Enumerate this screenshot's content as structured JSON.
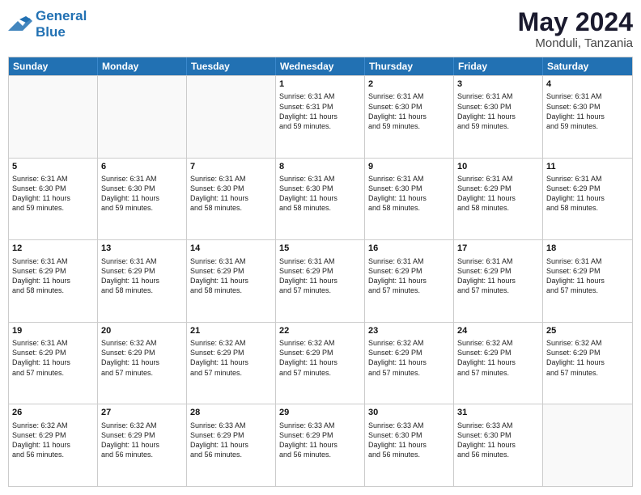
{
  "logo": {
    "line1": "General",
    "line2": "Blue"
  },
  "title": {
    "month_year": "May 2024",
    "location": "Monduli, Tanzania"
  },
  "header_days": [
    "Sunday",
    "Monday",
    "Tuesday",
    "Wednesday",
    "Thursday",
    "Friday",
    "Saturday"
  ],
  "rows": [
    [
      {
        "day": "",
        "info": "",
        "empty": true
      },
      {
        "day": "",
        "info": "",
        "empty": true
      },
      {
        "day": "",
        "info": "",
        "empty": true
      },
      {
        "day": "1",
        "info": "Sunrise: 6:31 AM\nSunset: 6:31 PM\nDaylight: 11 hours\nand 59 minutes.",
        "empty": false
      },
      {
        "day": "2",
        "info": "Sunrise: 6:31 AM\nSunset: 6:30 PM\nDaylight: 11 hours\nand 59 minutes.",
        "empty": false
      },
      {
        "day": "3",
        "info": "Sunrise: 6:31 AM\nSunset: 6:30 PM\nDaylight: 11 hours\nand 59 minutes.",
        "empty": false
      },
      {
        "day": "4",
        "info": "Sunrise: 6:31 AM\nSunset: 6:30 PM\nDaylight: 11 hours\nand 59 minutes.",
        "empty": false
      }
    ],
    [
      {
        "day": "5",
        "info": "Sunrise: 6:31 AM\nSunset: 6:30 PM\nDaylight: 11 hours\nand 59 minutes.",
        "empty": false
      },
      {
        "day": "6",
        "info": "Sunrise: 6:31 AM\nSunset: 6:30 PM\nDaylight: 11 hours\nand 59 minutes.",
        "empty": false
      },
      {
        "day": "7",
        "info": "Sunrise: 6:31 AM\nSunset: 6:30 PM\nDaylight: 11 hours\nand 58 minutes.",
        "empty": false
      },
      {
        "day": "8",
        "info": "Sunrise: 6:31 AM\nSunset: 6:30 PM\nDaylight: 11 hours\nand 58 minutes.",
        "empty": false
      },
      {
        "day": "9",
        "info": "Sunrise: 6:31 AM\nSunset: 6:30 PM\nDaylight: 11 hours\nand 58 minutes.",
        "empty": false
      },
      {
        "day": "10",
        "info": "Sunrise: 6:31 AM\nSunset: 6:29 PM\nDaylight: 11 hours\nand 58 minutes.",
        "empty": false
      },
      {
        "day": "11",
        "info": "Sunrise: 6:31 AM\nSunset: 6:29 PM\nDaylight: 11 hours\nand 58 minutes.",
        "empty": false
      }
    ],
    [
      {
        "day": "12",
        "info": "Sunrise: 6:31 AM\nSunset: 6:29 PM\nDaylight: 11 hours\nand 58 minutes.",
        "empty": false
      },
      {
        "day": "13",
        "info": "Sunrise: 6:31 AM\nSunset: 6:29 PM\nDaylight: 11 hours\nand 58 minutes.",
        "empty": false
      },
      {
        "day": "14",
        "info": "Sunrise: 6:31 AM\nSunset: 6:29 PM\nDaylight: 11 hours\nand 58 minutes.",
        "empty": false
      },
      {
        "day": "15",
        "info": "Sunrise: 6:31 AM\nSunset: 6:29 PM\nDaylight: 11 hours\nand 57 minutes.",
        "empty": false
      },
      {
        "day": "16",
        "info": "Sunrise: 6:31 AM\nSunset: 6:29 PM\nDaylight: 11 hours\nand 57 minutes.",
        "empty": false
      },
      {
        "day": "17",
        "info": "Sunrise: 6:31 AM\nSunset: 6:29 PM\nDaylight: 11 hours\nand 57 minutes.",
        "empty": false
      },
      {
        "day": "18",
        "info": "Sunrise: 6:31 AM\nSunset: 6:29 PM\nDaylight: 11 hours\nand 57 minutes.",
        "empty": false
      }
    ],
    [
      {
        "day": "19",
        "info": "Sunrise: 6:31 AM\nSunset: 6:29 PM\nDaylight: 11 hours\nand 57 minutes.",
        "empty": false
      },
      {
        "day": "20",
        "info": "Sunrise: 6:32 AM\nSunset: 6:29 PM\nDaylight: 11 hours\nand 57 minutes.",
        "empty": false
      },
      {
        "day": "21",
        "info": "Sunrise: 6:32 AM\nSunset: 6:29 PM\nDaylight: 11 hours\nand 57 minutes.",
        "empty": false
      },
      {
        "day": "22",
        "info": "Sunrise: 6:32 AM\nSunset: 6:29 PM\nDaylight: 11 hours\nand 57 minutes.",
        "empty": false
      },
      {
        "day": "23",
        "info": "Sunrise: 6:32 AM\nSunset: 6:29 PM\nDaylight: 11 hours\nand 57 minutes.",
        "empty": false
      },
      {
        "day": "24",
        "info": "Sunrise: 6:32 AM\nSunset: 6:29 PM\nDaylight: 11 hours\nand 57 minutes.",
        "empty": false
      },
      {
        "day": "25",
        "info": "Sunrise: 6:32 AM\nSunset: 6:29 PM\nDaylight: 11 hours\nand 57 minutes.",
        "empty": false
      }
    ],
    [
      {
        "day": "26",
        "info": "Sunrise: 6:32 AM\nSunset: 6:29 PM\nDaylight: 11 hours\nand 56 minutes.",
        "empty": false
      },
      {
        "day": "27",
        "info": "Sunrise: 6:32 AM\nSunset: 6:29 PM\nDaylight: 11 hours\nand 56 minutes.",
        "empty": false
      },
      {
        "day": "28",
        "info": "Sunrise: 6:33 AM\nSunset: 6:29 PM\nDaylight: 11 hours\nand 56 minutes.",
        "empty": false
      },
      {
        "day": "29",
        "info": "Sunrise: 6:33 AM\nSunset: 6:29 PM\nDaylight: 11 hours\nand 56 minutes.",
        "empty": false
      },
      {
        "day": "30",
        "info": "Sunrise: 6:33 AM\nSunset: 6:30 PM\nDaylight: 11 hours\nand 56 minutes.",
        "empty": false
      },
      {
        "day": "31",
        "info": "Sunrise: 6:33 AM\nSunset: 6:30 PM\nDaylight: 11 hours\nand 56 minutes.",
        "empty": false
      },
      {
        "day": "",
        "info": "",
        "empty": true
      }
    ]
  ]
}
